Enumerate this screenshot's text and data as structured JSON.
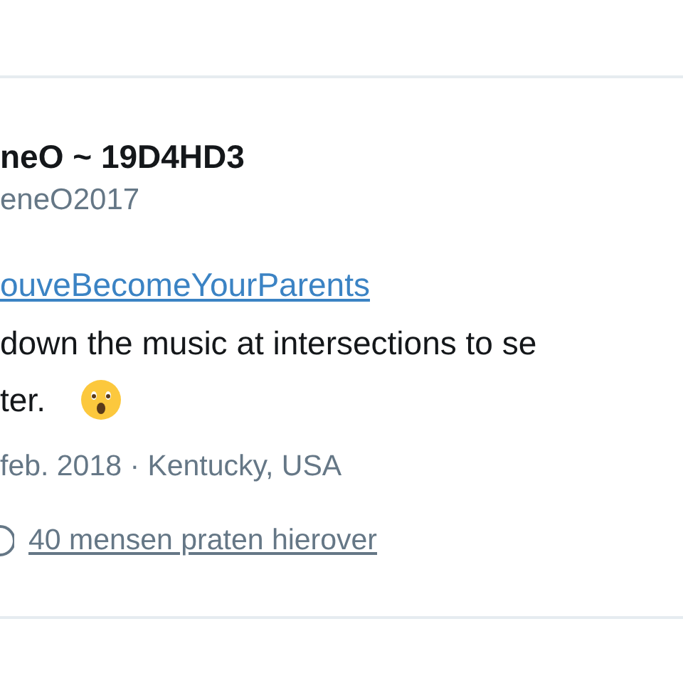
{
  "tweet": {
    "display_name": "neO ~ 19D4HD3",
    "handle": "eneO2017",
    "hashtag": "ouveBecomeYourParents",
    "text_lines": [
      "down the music at intersections to se",
      "ter."
    ],
    "date_location": "feb. 2018 · Kentucky, USA",
    "conversation": "40 mensen praten hierover"
  }
}
